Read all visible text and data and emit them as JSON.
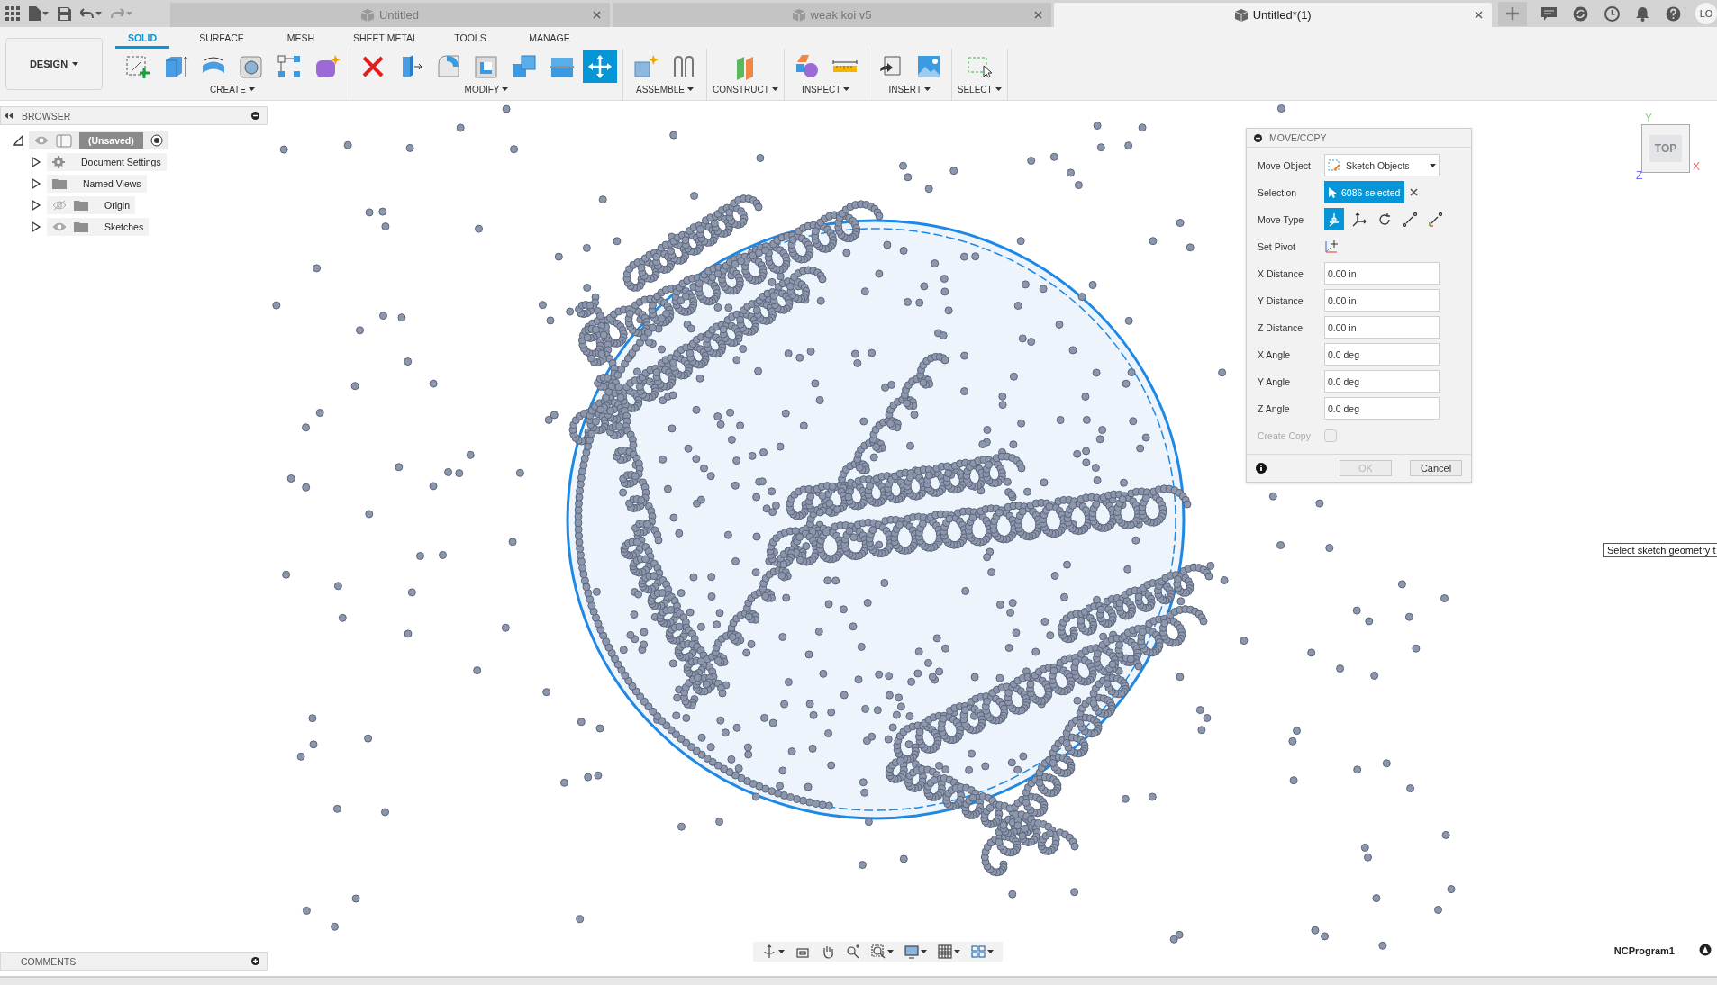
{
  "user": {
    "initials": "LO"
  },
  "documents": [
    {
      "title": "Untitled",
      "selected": false
    },
    {
      "title": "weak koi v5",
      "selected": false
    },
    {
      "title": "Untitled*(1)",
      "selected": true
    }
  ],
  "workspace": {
    "label": "DESIGN"
  },
  "toolbar_tabs": [
    {
      "label": "SOLID",
      "selected": true
    },
    {
      "label": "SURFACE",
      "selected": false
    },
    {
      "label": "MESH",
      "selected": false
    },
    {
      "label": "SHEET METAL",
      "selected": false
    },
    {
      "label": "TOOLS",
      "selected": false
    },
    {
      "label": "MANAGE",
      "selected": false
    }
  ],
  "tool_groups": [
    {
      "label": "CREATE",
      "tools": [
        {
          "kind": "sketch",
          "active": false
        },
        {
          "kind": "extrude",
          "active": false
        },
        {
          "kind": "revolve",
          "active": false
        },
        {
          "kind": "hole",
          "active": false
        },
        {
          "kind": "pattern",
          "active": false
        },
        {
          "kind": "form",
          "active": false
        }
      ]
    },
    {
      "label": "MODIFY",
      "tools": [
        {
          "kind": "delete",
          "active": false
        },
        {
          "kind": "presspull",
          "active": false
        },
        {
          "kind": "fillet",
          "active": false
        },
        {
          "kind": "shell",
          "active": false
        },
        {
          "kind": "combine",
          "active": false
        },
        {
          "kind": "split",
          "active": false
        },
        {
          "kind": "move",
          "active": true
        }
      ]
    },
    {
      "label": "ASSEMBLE",
      "tools": [
        {
          "kind": "joint",
          "active": false
        },
        {
          "kind": "asbuilt",
          "active": false
        }
      ]
    },
    {
      "label": "CONSTRUCT",
      "tools": [
        {
          "kind": "plane",
          "active": false
        }
      ]
    },
    {
      "label": "INSPECT",
      "tools": [
        {
          "kind": "shapes",
          "active": false
        },
        {
          "kind": "measure",
          "active": false
        }
      ]
    },
    {
      "label": "INSERT",
      "tools": [
        {
          "kind": "insert",
          "active": false
        },
        {
          "kind": "canvas",
          "active": false
        }
      ]
    },
    {
      "label": "SELECT",
      "tools": [
        {
          "kind": "select",
          "active": false
        }
      ]
    }
  ],
  "browser": {
    "title": "BROWSER",
    "root": {
      "label": "(Unsaved)",
      "expanded": true,
      "visible": true,
      "children": [
        {
          "label": "Document Settings",
          "kind": "settings"
        },
        {
          "label": "Named Views",
          "kind": "folder"
        },
        {
          "label": "Origin",
          "kind": "folder",
          "visible": false
        },
        {
          "label": "Sketches",
          "kind": "folder",
          "visible": true
        }
      ]
    }
  },
  "comments": {
    "title": "COMMENTS"
  },
  "move_copy": {
    "title": "MOVE/COPY",
    "rows": [
      {
        "kind": "dropdown",
        "label": "Move Object",
        "value": "Sketch Objects"
      },
      {
        "kind": "selection",
        "label": "Selection",
        "value": "6086 selected"
      },
      {
        "kind": "options",
        "label": "Move Type",
        "options": [
          {
            "kind": "free",
            "selected": true
          },
          {
            "kind": "translate",
            "selected": false
          },
          {
            "kind": "rotate",
            "selected": false
          },
          {
            "kind": "point",
            "selected": false
          },
          {
            "kind": "position",
            "selected": false
          }
        ]
      },
      {
        "kind": "pivot",
        "label": "Set Pivot"
      },
      {
        "kind": "field",
        "label": "X Distance",
        "value": "0.00 in"
      },
      {
        "kind": "field",
        "label": "Y Distance",
        "value": "0.00 in"
      },
      {
        "kind": "field",
        "label": "Z Distance",
        "value": "0.00 in"
      },
      {
        "kind": "field",
        "label": "X Angle",
        "value": "0.0 deg"
      },
      {
        "kind": "field",
        "label": "Y Angle",
        "value": "0.0 deg"
      },
      {
        "kind": "field",
        "label": "Z Angle",
        "value": "0.0 deg"
      },
      {
        "kind": "checkbox",
        "label": "Create Copy",
        "checked": false,
        "disabled": true
      }
    ],
    "buttons": [
      {
        "label": "OK",
        "disabled": true
      },
      {
        "label": "Cancel",
        "disabled": false
      }
    ]
  },
  "view_cube": {
    "face": "TOP",
    "axes": [
      "Y",
      "X",
      "Z"
    ]
  },
  "tooltip": "Select sketch geometry t",
  "status": "NCProgram1"
}
